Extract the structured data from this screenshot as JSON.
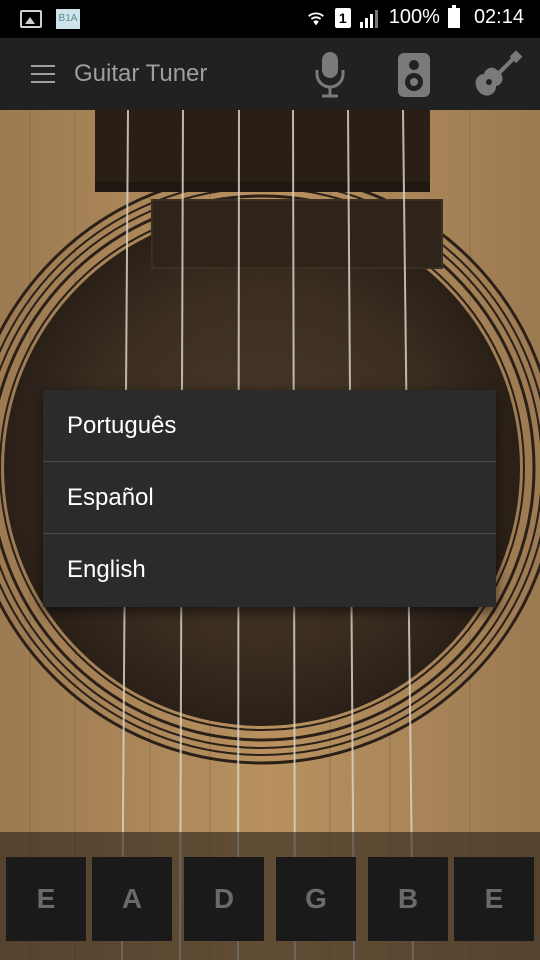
{
  "status_bar": {
    "app_badge": "B1A",
    "sim": "1",
    "battery": "100%",
    "time": "02:14"
  },
  "app_bar": {
    "title": "Guitar Tuner"
  },
  "language_menu": {
    "items": [
      "Português",
      "Español",
      "English"
    ]
  },
  "strings": {
    "notes": [
      "E",
      "A",
      "D",
      "G",
      "B",
      "E"
    ]
  },
  "colors": {
    "app_bar": "#212121",
    "menu_bg": "#2b2b2b",
    "wood": "#b08a5e"
  }
}
